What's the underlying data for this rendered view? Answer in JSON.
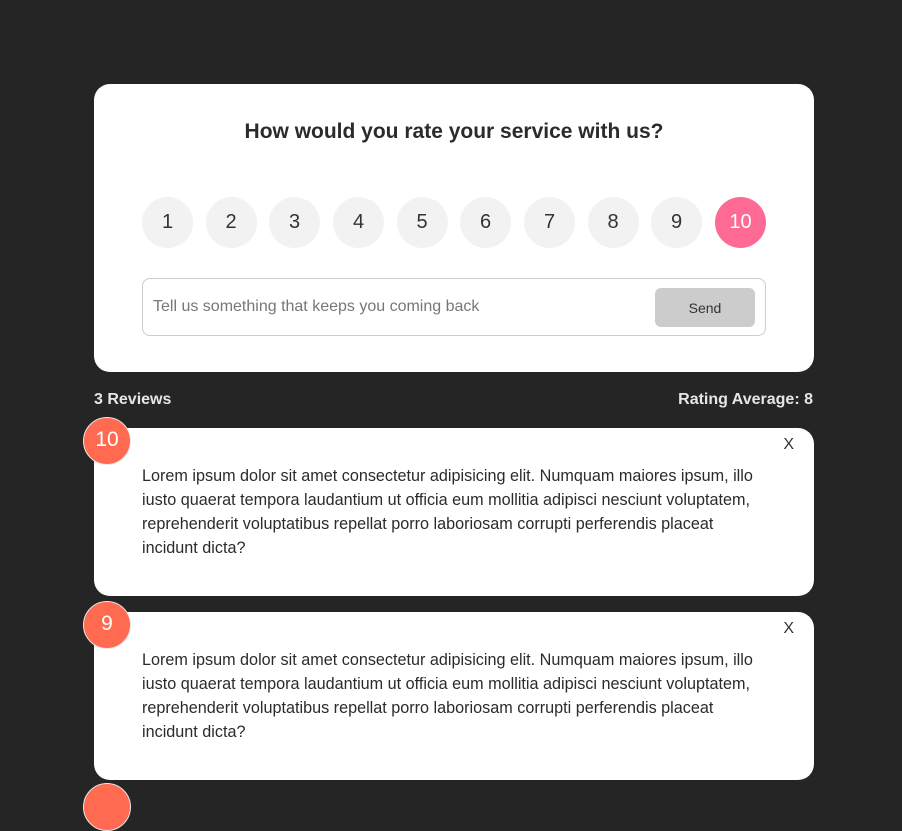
{
  "form": {
    "title": "How would you rate your service with us?",
    "ratings": [
      "1",
      "2",
      "3",
      "4",
      "5",
      "6",
      "7",
      "8",
      "9",
      "10"
    ],
    "selected_rating": "10",
    "review_placeholder": "Tell us something that keeps you coming back",
    "review_value": "",
    "send_label": "Send"
  },
  "stats": {
    "count_label": "3 Reviews",
    "average_label": "Rating Average: 8"
  },
  "reviews": [
    {
      "rating": "10",
      "text": "Lorem ipsum dolor sit amet consectetur adipisicing elit. Numquam maiores ipsum, illo iusto quaerat tempora laudantium ut officia eum mollitia adipisci nesciunt voluptatem, reprehenderit voluptatibus repellat porro laboriosam corrupti perferendis placeat incidunt dicta?",
      "delete_label": "X"
    },
    {
      "rating": "9",
      "text": "Lorem ipsum dolor sit amet consectetur adipisicing elit. Numquam maiores ipsum, illo iusto quaerat tempora laudantium ut officia eum mollitia adipisci nesciunt voluptatem, reprehenderit voluptatibus repellat porro laboriosam corrupti perferendis placeat incidunt dicta?",
      "delete_label": "X"
    }
  ],
  "colors": {
    "background": "#252525",
    "selected_rating": "#ff6a95",
    "review_badge": "#ff6a50",
    "send_button": "#cccccc"
  }
}
